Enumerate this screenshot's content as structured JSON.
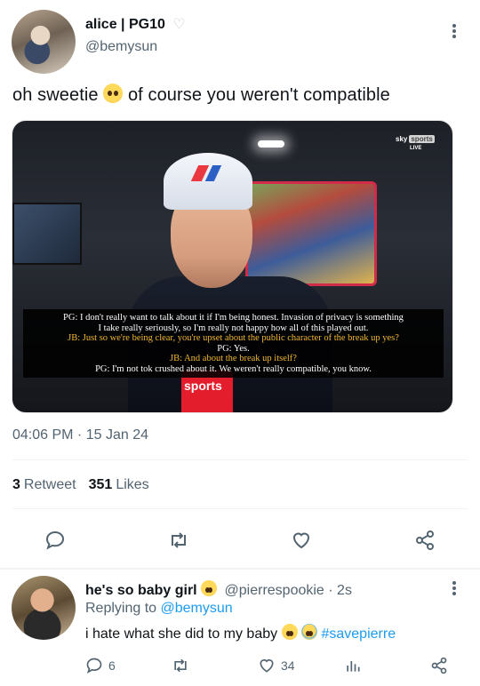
{
  "tweet": {
    "author_name": "alice | PG10",
    "author_badge": "♡",
    "author_handle": "@bemysun",
    "text_before_emoji": "oh sweetie ",
    "text_after_emoji": " of course you weren't compatible",
    "emoji": "pleading-face-emoji",
    "timestamp": "04:06 PM · 15 Jan 24",
    "retweet_count": "3",
    "retweet_label": "Retweet",
    "likes_count": "351",
    "likes_label": "Likes",
    "media": {
      "broadcaster_logo": "sky",
      "broadcaster_logo_suffix": "sports",
      "live_label": "LIVE",
      "mic_label": "sports",
      "subtitles": [
        {
          "speaker_color": "#ffffff",
          "text": "PG: I don't really want to talk about it if I'm being honest. Invasion of privacy is something"
        },
        {
          "speaker_color": "#ffffff",
          "text": "I take really seriously, so I'm really not happy how all of this played out."
        },
        {
          "speaker_color": "#f2b733",
          "text": "JB: Just so we're being clear, you're upset about the public character of the break up yes?"
        },
        {
          "speaker_color": "#ffffff",
          "text": "PG: Yes."
        },
        {
          "speaker_color": "#f2b733",
          "text": "JB: And about the break up itself?"
        },
        {
          "speaker_color": "#ffffff",
          "text": "PG: I'm not tok crushed about it. We weren't really compatible, you know."
        }
      ]
    },
    "actions": [
      "reply-icon",
      "retweet-icon",
      "like-icon",
      "share-icon"
    ]
  },
  "reply": {
    "author_name": "he's so baby girl",
    "author_handle": "@pierrespookie · 2s",
    "replying_label": "Replying to",
    "replying_to": "@bemysun",
    "text": "i hate what she did to my baby",
    "hashtag": "#savepierre",
    "reply_count": "6",
    "like_count": "34"
  },
  "colors": {
    "text_primary": "#0f1419",
    "text_secondary": "#536471",
    "link": "#1d9bf0",
    "subtitle_yellow": "#f2b733"
  }
}
